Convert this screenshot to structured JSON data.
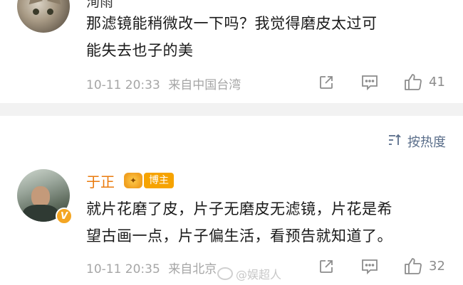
{
  "comments": [
    {
      "username": "洵雨",
      "text_line1": "那滤镜能稍微改一下吗？我觉得磨皮太过可",
      "text_line2": "能失去也子的美",
      "timestamp": "10-11 20:33",
      "location": "来自中国台湾",
      "like_count": "41"
    },
    {
      "username": "于正",
      "badge_label": "博主",
      "verified_letter": "V",
      "text_line1": "就片花磨了皮，片子无磨皮无滤镜，片花是希",
      "text_line2": "望古画一点，片子偏生活，看预告就知道了。",
      "timestamp": "10-11 20:35",
      "location": "来自北京",
      "like_count": "32"
    }
  ],
  "sort": {
    "label": "按热度"
  },
  "watermark": {
    "text": "@娱超人"
  },
  "colors": {
    "accent_orange": "#ea7a0c",
    "sort_blue": "#5a6e8a",
    "meta_gray": "#a6a6a6",
    "divider": "#f2f2f2"
  },
  "icons": [
    "share-icon",
    "comment-icon",
    "like-icon",
    "sort-icon",
    "weibo-logo-icon"
  ]
}
